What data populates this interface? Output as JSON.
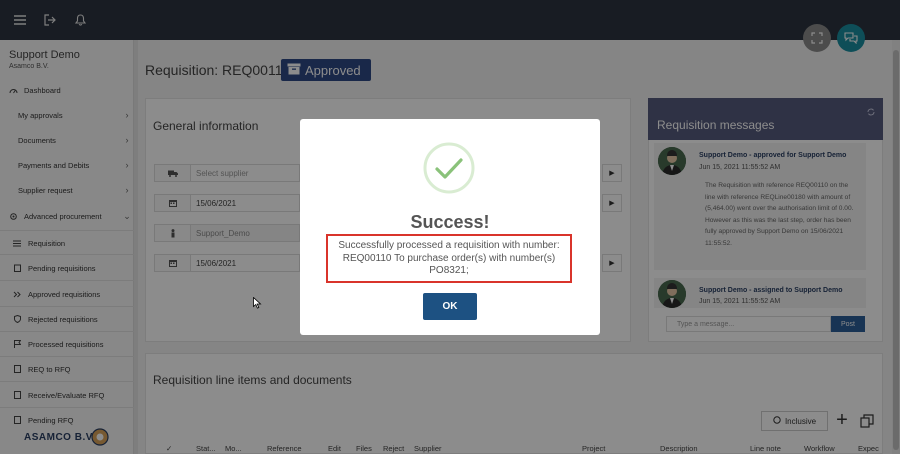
{
  "topbar": {
    "icons": [
      "menu-icon",
      "logout-icon",
      "bell-icon"
    ]
  },
  "sidebar": {
    "org_title": "Support Demo",
    "org_subtitle": "Asamco B.V.",
    "items": [
      {
        "label": "Dashboard",
        "icon": "dashboard-icon"
      },
      {
        "label": "My approvals"
      },
      {
        "label": "Documents"
      },
      {
        "label": "Payments and Debits"
      },
      {
        "label": "Supplier request"
      },
      {
        "label": "Advanced procurement",
        "icon": "gear-icon"
      },
      {
        "label": "Requisition",
        "icon": "list-icon"
      },
      {
        "label": "Pending requisitions",
        "icon": "clipboard-icon"
      },
      {
        "label": "Approved requisitions",
        "icon": "double-chevron-icon"
      },
      {
        "label": "Rejected requisitions",
        "icon": "shield-icon"
      },
      {
        "label": "Processed requisitions",
        "icon": "flag-icon"
      },
      {
        "label": "REQ to RFQ",
        "icon": "document-icon"
      },
      {
        "label": "Receive/Evaluate RFQ",
        "icon": "document-icon"
      },
      {
        "label": "Pending RFQ",
        "icon": "document-icon"
      }
    ],
    "brand": "ASAMCO B.V."
  },
  "header": {
    "title": "Requisition: REQ00110",
    "status": "Approved"
  },
  "general": {
    "title": "General information",
    "supplier_placeholder": "Select supplier",
    "date1": "15/06/2021",
    "requester": "Support_Demo",
    "date2": "15/06/2021"
  },
  "messages": {
    "title": "Requisition messages",
    "items": [
      {
        "author": "Support Demo - approved for Support Demo",
        "time": "Jun 15, 2021 11:55:52 AM",
        "body": "The Requisition with reference REQ00110 on the line with reference REQLine00180 with amount of (5,464.00) went over the authorisation limit of 0.00. However as this was the last step, order has been fully approved by Support Demo on 15/06/2021 11:55:52."
      },
      {
        "author": "Support Demo - assigned to Support Demo",
        "time": "Jun 15, 2021 11:55:52 AM"
      }
    ],
    "input_placeholder": "Type a message...",
    "post_label": "Post"
  },
  "lines": {
    "title": "Requisition line items and documents",
    "inclusive_label": "Inclusive",
    "columns": [
      "Stat...",
      "Mo...",
      "Reference",
      "Edit",
      "Files",
      "Reject",
      "Supplier",
      "Project",
      "Description",
      "Line note",
      "Workflow",
      "Expec"
    ]
  },
  "modal": {
    "title": "Success!",
    "message": "Successfully processed a requisition with number: REQ00110 To purchase order(s) with number(s) PO8321;",
    "ok_label": "OK"
  },
  "colors": {
    "topbar": "#2c3440",
    "badge": "#2e4a86",
    "messages_header": "#565b7f",
    "ok_button": "#1d5182",
    "highlight_border": "#d9342b",
    "success_check": "#8ac27a"
  }
}
